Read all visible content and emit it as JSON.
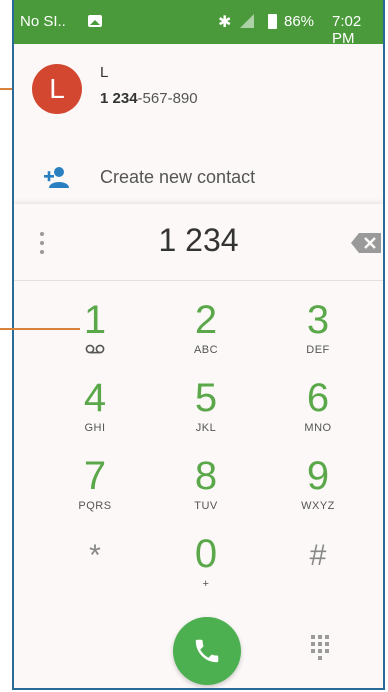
{
  "status_bar": {
    "carrier": "No SI..",
    "battery_percent": "86%",
    "time": "7:02 PM"
  },
  "suggestion": {
    "avatar_letter": "L",
    "name": "L",
    "number_bold": "1 234",
    "number_rest": "-567-890"
  },
  "create_contact": {
    "label": "Create new contact"
  },
  "dialer": {
    "digits": "1 234"
  },
  "keys": [
    {
      "digit": "1",
      "letters": ""
    },
    {
      "digit": "2",
      "letters": "ABC"
    },
    {
      "digit": "3",
      "letters": "DEF"
    },
    {
      "digit": "4",
      "letters": "GHI"
    },
    {
      "digit": "5",
      "letters": "JKL"
    },
    {
      "digit": "6",
      "letters": "MNO"
    },
    {
      "digit": "7",
      "letters": "PQRS"
    },
    {
      "digit": "8",
      "letters": "TUV"
    },
    {
      "digit": "9",
      "letters": "WXYZ"
    },
    {
      "digit": "*",
      "letters": ""
    },
    {
      "digit": "0",
      "letters": "+"
    },
    {
      "digit": "#",
      "letters": ""
    }
  ],
  "icons": {
    "voicemail": "voicemail-icon",
    "add_contact": "add-person-icon",
    "backspace": "backspace-icon",
    "call": "phone-icon",
    "keypad": "dialpad-icon",
    "overflow": "overflow-menu-icon"
  },
  "colors": {
    "status_bar": "#4a9a3b",
    "avatar": "#d3462f",
    "key_digit": "#5aa84a",
    "call_button": "#4caf50",
    "callout": "#d9823b",
    "frame_border": "#2a6a98"
  }
}
